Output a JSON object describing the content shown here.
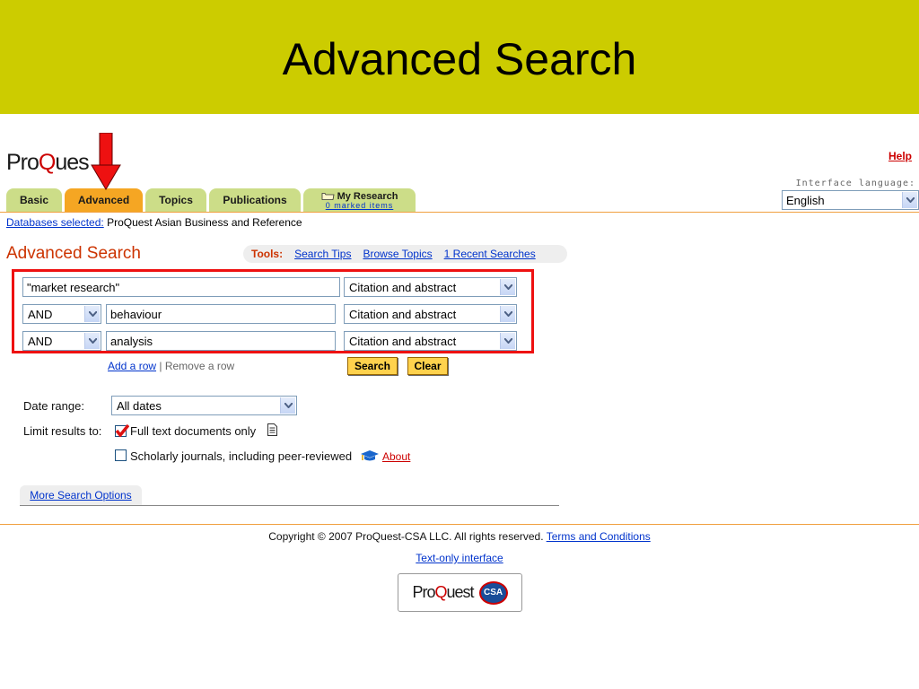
{
  "slide": {
    "title": "Advanced Search"
  },
  "logo": {
    "pre": "Pro",
    "swoosh": "Q",
    "post": "ues"
  },
  "header": {
    "help_label": "Help",
    "interface_language_label": "Interface language:",
    "interface_language_value": "English"
  },
  "tabs": [
    {
      "label": "Basic",
      "active": false
    },
    {
      "label": "Advanced",
      "active": true
    },
    {
      "label": "Topics",
      "active": false
    },
    {
      "label": "Publications",
      "active": false
    }
  ],
  "my_research": {
    "icon": "folder-icon",
    "title": "My Research",
    "marked_items": "0 marked items"
  },
  "databases": {
    "label": "Databases selected:",
    "value": "ProQuest Asian Business and Reference"
  },
  "page": {
    "heading": "Advanced Search"
  },
  "tools": {
    "label": "Tools:",
    "links": [
      "Search Tips",
      "Browse Topics",
      "1 Recent Searches"
    ]
  },
  "search_rows": [
    {
      "operator": "",
      "term": "\"market research\"",
      "field": "Citation and abstract"
    },
    {
      "operator": "AND",
      "term": "behaviour",
      "field": "Citation and abstract"
    },
    {
      "operator": "AND",
      "term": "analysis",
      "field": "Citation and abstract"
    }
  ],
  "row_actions": {
    "add": "Add a row",
    "separator": "|",
    "remove": "Remove a row"
  },
  "buttons": {
    "search": "Search",
    "clear": "Clear"
  },
  "date_range": {
    "label": "Date range:",
    "value": "All dates"
  },
  "limits": {
    "label": "Limit results to:",
    "full_text": {
      "label": "Full text documents only",
      "checked": true
    },
    "scholarly": {
      "label": "Scholarly journals, including peer-reviewed",
      "checked": false,
      "about": "About"
    }
  },
  "more_options": "More Search Options",
  "footer": {
    "copyright": "Copyright © 2007 ProQuest-CSA LLC. All rights reserved.",
    "terms": "Terms and Conditions",
    "text_only": "Text-only interface",
    "logo_pre": "Pro",
    "logo_swoosh": "Q",
    "logo_post": "uest",
    "csa": "CSA"
  },
  "colors": {
    "slide_header": "#cccc00",
    "tab_inactive": "#ccdd88",
    "tab_active": "#f5a623",
    "highlight_box": "#ee1111",
    "link": "#0033cc",
    "heading": "#cc3300"
  },
  "annotation": {
    "arrow": "red-arrow-icon"
  }
}
